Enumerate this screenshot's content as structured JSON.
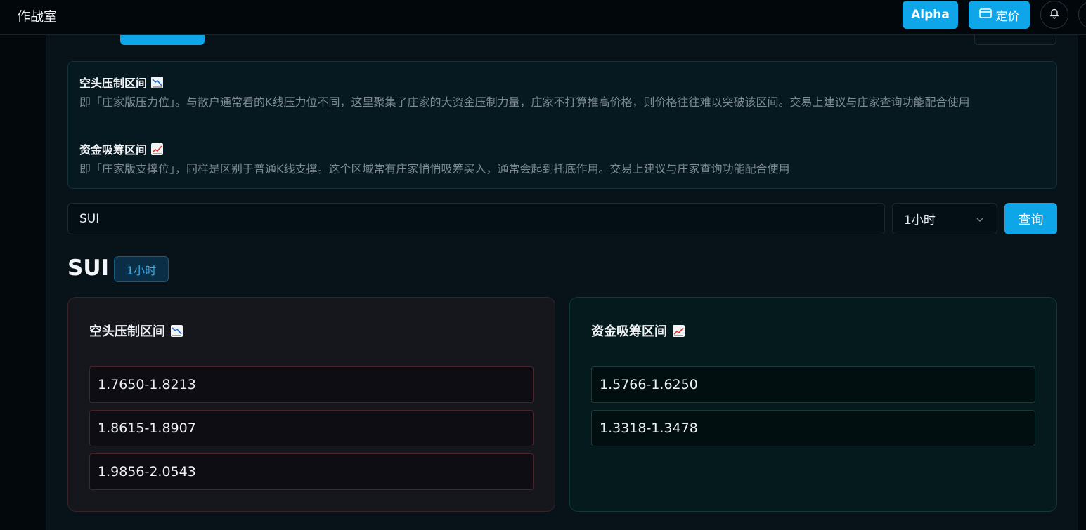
{
  "app": {
    "title": "作战室"
  },
  "header": {
    "alpha_label": "Alpha",
    "pricing_label": "定价",
    "icons": [
      "card-icon",
      "bell-icon",
      "avatar"
    ]
  },
  "info": {
    "short_title": "空头压制区间",
    "short_desc": "即「庄家版压力位」。与散户通常看的K线压力位不同，这里聚集了庄家的大资金压制力量，庄家不打算推高价格，则价格往往难以突破该区间。交易上建议与庄家查询功能配合使用",
    "long_title": "资金吸筹区间",
    "long_desc": "即「庄家版支撑位」，同样是区别于普通K线支撑。这个区域常有庄家悄悄吸筹买入，通常会起到托底作用。交易上建议与庄家查询功能配合使用"
  },
  "search": {
    "value": "SUI",
    "interval_selected": "1小时",
    "query_label": "查询"
  },
  "result": {
    "symbol": "SUI",
    "interval": "1小时",
    "short_card": {
      "title": "空头压制区间",
      "zones": [
        "1.7650-1.8213",
        "1.8615-1.8907",
        "1.9856-2.0543"
      ]
    },
    "long_card": {
      "title": "资金吸筹区间",
      "zones": [
        "1.5766-1.6250",
        "1.3318-1.3478"
      ]
    }
  },
  "colors": {
    "accent": "#0ea5e9",
    "short_card_bg": "#16161d",
    "long_card_bg": "#041a1c"
  }
}
